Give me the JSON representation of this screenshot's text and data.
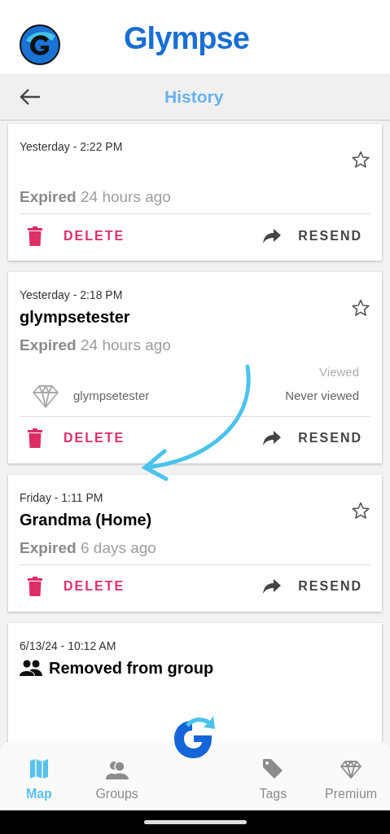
{
  "app": {
    "title": "Glympse"
  },
  "toolbar": {
    "title": "History"
  },
  "history": [
    {
      "time": "Yesterday - 2:22 PM",
      "starred": false,
      "status": "**Expired** 24 hours ago",
      "actions": [
        "DELETE",
        "RESEND"
      ]
    },
    {
      "time": "Yesterday - 2:18 PM",
      "title": "glympsetester",
      "starred": false,
      "status": "**Expired** 24 hours ago",
      "viewed_header": "Viewed",
      "recipients": [
        {
          "name": "glympsetester",
          "viewed": "Never viewed"
        }
      ],
      "actions": [
        "DELETE",
        "RESEND"
      ]
    },
    {
      "time": "Friday - 1:11 PM",
      "title": "Grandma (Home)",
      "starred": false,
      "status": "**Expired** 6 days ago",
      "actions": [
        "DELETE",
        "RESEND"
      ]
    },
    {
      "time": "6/13/24 - 10:12 AM",
      "title": "Removed from group",
      "kind": "group"
    }
  ],
  "nav": [
    {
      "label": "Map",
      "kind": "map",
      "selected": true
    },
    {
      "label": "Groups",
      "kind": "groups",
      "selected": false
    },
    {
      "kind": "logo"
    },
    {
      "label": "Tags",
      "kind": "tags",
      "selected": false
    },
    {
      "label": "Premium",
      "kind": "premium",
      "selected": false
    }
  ]
}
